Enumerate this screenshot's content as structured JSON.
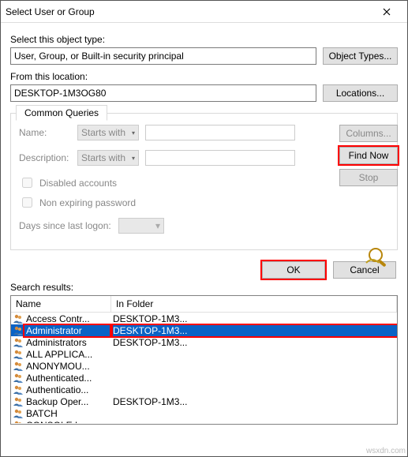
{
  "window": {
    "title": "Select User or Group"
  },
  "labels": {
    "object_type": "Select this object type:",
    "location": "From this location:",
    "tab": "Common Queries",
    "name": "Name:",
    "description": "Description:",
    "disabled": "Disabled accounts",
    "nonexp": "Non expiring password",
    "days": "Days since last logon:",
    "search_results": "Search results:"
  },
  "fields": {
    "object_type_value": "User, Group, or Built-in security principal",
    "location_value": "DESKTOP-1M3OG80",
    "combo_starts": "Starts with"
  },
  "buttons": {
    "object_types": "Object Types...",
    "locations": "Locations...",
    "columns": "Columns...",
    "find_now": "Find Now",
    "stop": "Stop",
    "ok": "OK",
    "cancel": "Cancel"
  },
  "columns": {
    "name": "Name",
    "in_folder": "In Folder"
  },
  "results": [
    {
      "name": "Access Contr...",
      "folder": "DESKTOP-1M3..."
    },
    {
      "name": "Administrator",
      "folder": "DESKTOP-1M3..."
    },
    {
      "name": "Administrators",
      "folder": "DESKTOP-1M3..."
    },
    {
      "name": "ALL APPLICA...",
      "folder": ""
    },
    {
      "name": "ANONYMOU...",
      "folder": ""
    },
    {
      "name": "Authenticated...",
      "folder": ""
    },
    {
      "name": "Authenticatio...",
      "folder": ""
    },
    {
      "name": "Backup Oper...",
      "folder": "DESKTOP-1M3..."
    },
    {
      "name": "BATCH",
      "folder": ""
    },
    {
      "name": "CONSOLE L...",
      "folder": ""
    }
  ],
  "selected_index": 1,
  "watermark": "wsxdn.com"
}
